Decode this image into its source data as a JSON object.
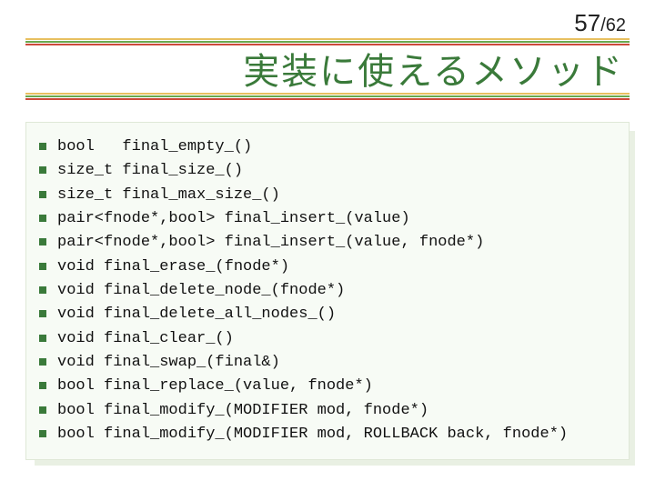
{
  "pager": {
    "current": "57",
    "sep": "/",
    "total": "62"
  },
  "title": "実装に使えるメソッド",
  "methods": [
    "bool   final_empty_()",
    "size_t final_size_()",
    "size_t final_max_size_()",
    "pair<fnode*,bool> final_insert_(value)",
    "pair<fnode*,bool> final_insert_(value, fnode*)",
    "void final_erase_(fnode*)",
    "void final_delete_node_(fnode*)",
    "void final_delete_all_nodes_()",
    "void final_clear_()",
    "void final_swap_(final&)",
    "bool final_replace_(value, fnode*)",
    "bool final_modify_(MODIFIER mod, fnode*)",
    "bool final_modify_(MODIFIER mod, ROLLBACK back, fnode*)"
  ]
}
